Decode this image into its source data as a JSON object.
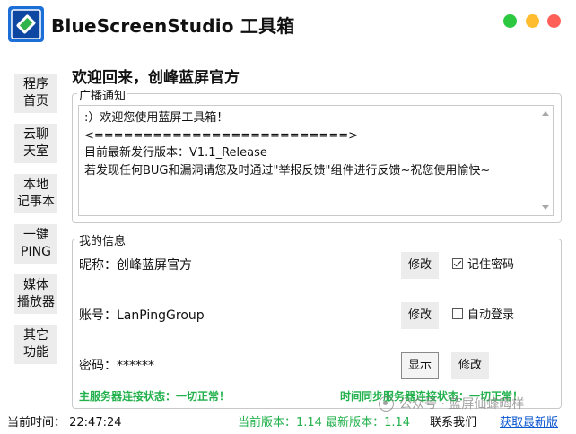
{
  "app": {
    "title": "BlueScreenStudio 工具箱",
    "icon": "bluescreen-logo-icon",
    "window_controls": {
      "minimize_color": "#2bc840",
      "maximize_color": "#febc2e",
      "close_color": "#ff5f57"
    }
  },
  "sidebar": {
    "items": [
      {
        "label": "程序\n首页"
      },
      {
        "label": "云聊\n天室"
      },
      {
        "label": "本地\n记事本"
      },
      {
        "label": "一键\nPING"
      },
      {
        "label": "媒体\n播放器"
      },
      {
        "label": "其它\n功能"
      }
    ]
  },
  "welcome": "欢迎回来，创峰蓝屏官方",
  "broadcast": {
    "title": "广播通知",
    "lines": [
      ":）欢迎您使用蓝屏工具箱！",
      "<==========================>",
      "目前最新发行版本：V1.1_Release",
      "若发现任何BUG和漏洞请您及时通过\"举报反馈\"组件进行反馈~祝您使用愉快~"
    ]
  },
  "my_info": {
    "title": "我的信息",
    "nickname_label": "昵称：创峰蓝屏官方",
    "account_label": "账号：LanPingGroup",
    "password_label": "密码：******",
    "modify_label": "修改",
    "show_label": "显示",
    "remember_password": {
      "label": "记住密码",
      "checked": true
    },
    "auto_login": {
      "label": "自动登录",
      "checked": false
    },
    "main_server_status": "主服务器连接状态：一切正常！",
    "time_server_status": "时间同步服务器连接状态：一切正常！"
  },
  "footer": {
    "current_time": "当前时间：  22:47:24",
    "version_info": "当前版本：1.14 最新版本：1.14",
    "contact": "联系我们",
    "get_latest": "获取最新版",
    "watermark": "公众号 · 蓝屏仙蜂晦样"
  },
  "colors": {
    "status_green": "#22b14c",
    "link_blue": "#0b57d0",
    "button_gray": "#ececec"
  }
}
